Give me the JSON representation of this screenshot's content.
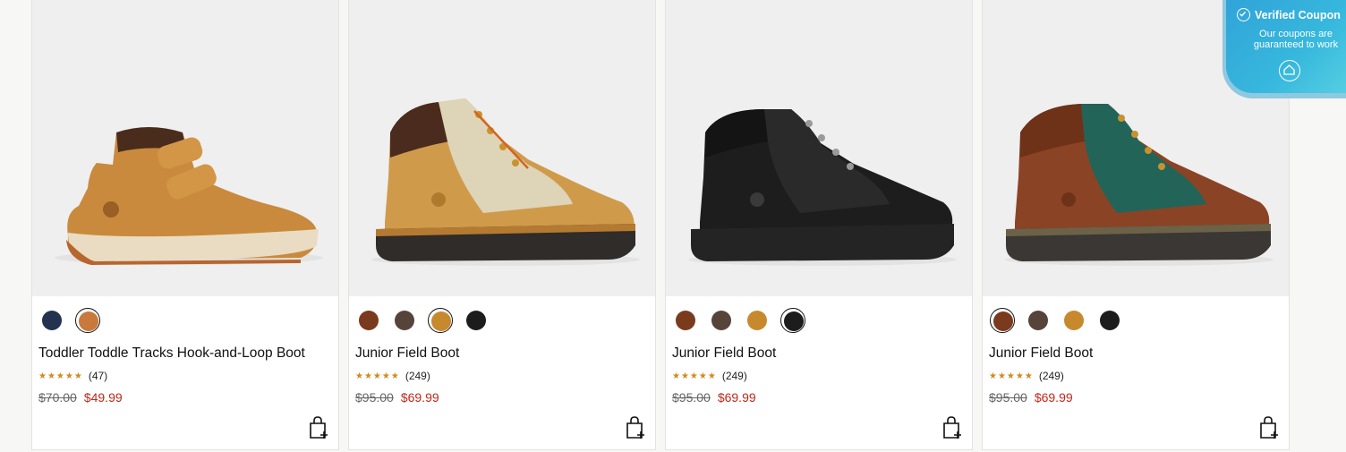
{
  "products": [
    {
      "title": "Toddler Toddle Tracks Hook-and-Loop Boot",
      "rating_stars": "★★★★★",
      "review_count": "(47)",
      "price_original": "$70.00",
      "price_sale": "$49.99",
      "swatches": [
        "#22324f",
        "#c8793b"
      ],
      "selected_swatch": 1
    },
    {
      "title": "Junior Field Boot",
      "rating_stars": "★★★★★",
      "review_count": "(249)",
      "price_original": "$95.00",
      "price_sale": "$69.99",
      "swatches": [
        "#7a3a1e",
        "#56443a",
        "#c7892e",
        "#1c1c1c"
      ],
      "selected_swatch": 2
    },
    {
      "title": "Junior Field Boot",
      "rating_stars": "★★★★★",
      "review_count": "(249)",
      "price_original": "$95.00",
      "price_sale": "$69.99",
      "swatches": [
        "#7a3a1e",
        "#56443a",
        "#c7892e",
        "#1c1c1c"
      ],
      "selected_swatch": 3
    },
    {
      "title": "Junior Field Boot",
      "rating_stars": "★★★★★",
      "review_count": "(249)",
      "price_original": "$95.00",
      "price_sale": "$69.99",
      "swatches": [
        "#7a3a1e",
        "#56443a",
        "#c7892e",
        "#1c1c1c"
      ],
      "selected_swatch": 0
    }
  ],
  "coupon": {
    "title": "Verified Coupon",
    "subtitle": "Our coupons are guaranteed to work"
  },
  "icons": {
    "bag": "add-to-bag-icon",
    "coupon_check": "check-circle-icon",
    "coupon_logo": "coupon-logo-icon"
  },
  "colors": {
    "sale_price": "#c0281b",
    "star": "#d08a1d",
    "coupon_bg": "#37b8dd"
  }
}
